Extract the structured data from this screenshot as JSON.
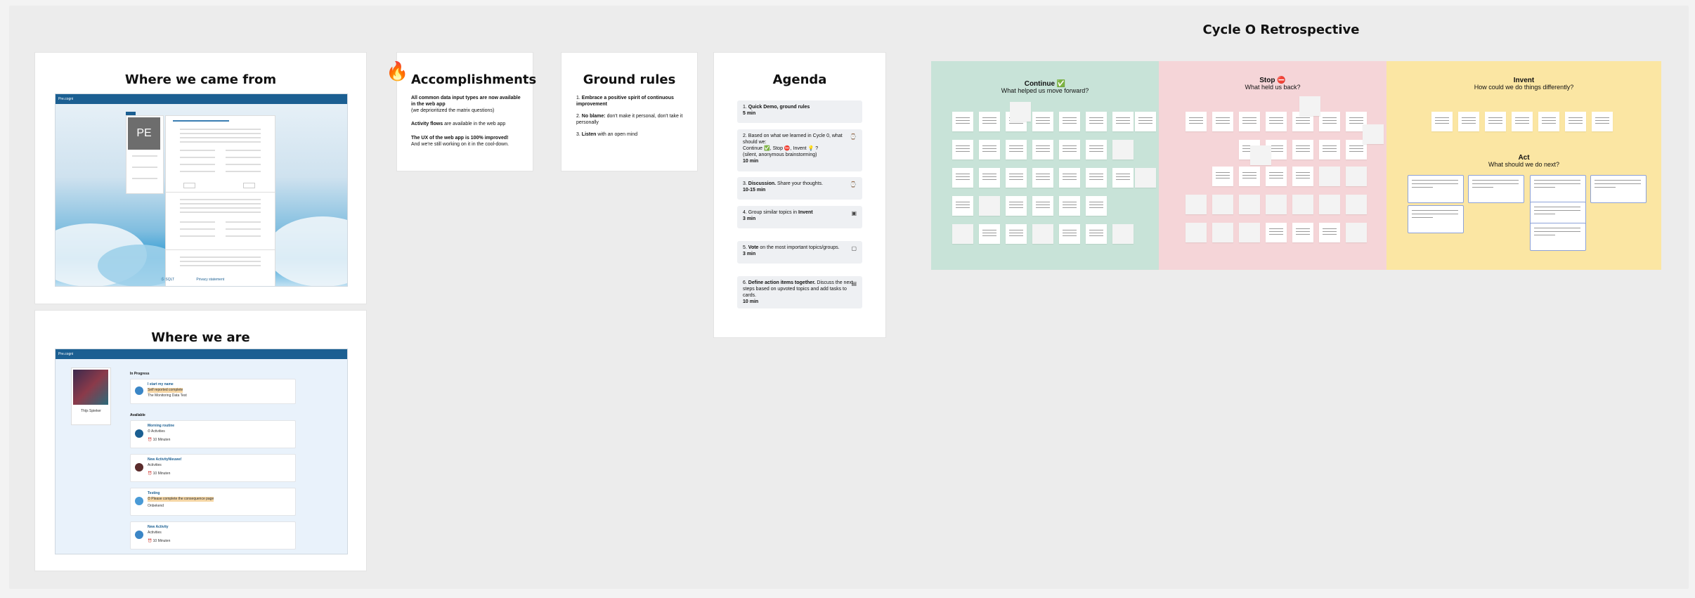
{
  "frames": {
    "came_from": {
      "title": "Where we came from"
    },
    "where_we_are": {
      "title": "Where we are"
    },
    "accomplishments": {
      "title": "Accomplishments",
      "items": [
        {
          "bold": "All common data input types are now available in the web app",
          "rest": "(we deprioritized the matrix questions)"
        },
        {
          "bold": "Activity flows",
          "rest": " are available in the web app"
        },
        {
          "bold": "The UX of the web app is 100% improved!",
          "rest": "And we're still working on it in the cool-down."
        }
      ]
    },
    "ground_rules": {
      "title": "Ground rules",
      "items": [
        {
          "num": "1.",
          "bold": "Embrace a positive spirit of continuous improvement",
          "rest": ""
        },
        {
          "num": "2.",
          "bold": "No blame:",
          "rest": " don't make it personal, don't take it personally"
        },
        {
          "num": "3.",
          "bold": "Listen",
          "rest": " with an open mind"
        }
      ]
    },
    "agenda": {
      "title": "Agenda",
      "items": [
        {
          "num": "1.",
          "bold": "Quick Demo, ground rules",
          "rest": "",
          "time": "5 min",
          "icon": ""
        },
        {
          "num": "2.",
          "bold": "",
          "rest": "Based on what we learned in Cycle 0, what should we:",
          "line2": "Continue ✅, Stop ⛔, Invent 💡 ?",
          "line3": "(silent, anonymous brainstorming)",
          "time": "10 min",
          "icon": "⌚"
        },
        {
          "num": "3.",
          "bold": "Discussion.",
          "rest": " Share your thoughts.",
          "time": "10-15 min",
          "icon": "⌚"
        },
        {
          "num": "4.",
          "bold": "",
          "rest": "Group similar topics in ",
          "bold2": "Invent",
          "time": "3 min",
          "icon": "▣"
        },
        {
          "num": "5.",
          "bold": "Vote",
          "rest": " on the most important topics/groups.",
          "time": "3 min",
          "icon": "▢"
        },
        {
          "num": "6.",
          "bold": "Define action items together.",
          "rest": " Discuss the next steps based on upvoted topics and add tasks to cards.",
          "time": "10 min",
          "icon": "▤"
        }
      ]
    },
    "retro": {
      "title": "Cycle O Retrospective",
      "columns": [
        {
          "title": "Continue ✅",
          "subtitle": "What helped us move forward?",
          "color": "#c8e3d8"
        },
        {
          "title": "Stop ⛔",
          "subtitle": "What held us back?",
          "color": "#f5d5d8"
        },
        {
          "title": "Invent",
          "subtitle": "How could we do things differently?",
          "color": "#fbe6a3",
          "section2_title": "Act",
          "section2_subtitle": "What should we do next?"
        }
      ]
    }
  },
  "screens": {
    "old_app": {
      "brand": "Pre.cogni",
      "avatar_initials": "PE",
      "success_tag": "Ⓢ SQLT",
      "footer_link": "Privacy statement"
    },
    "new_app": {
      "brand": "Pre.cogni",
      "section_in_progress": "In Progress",
      "section_available": "Available",
      "profile_name": "Thijs Spieker",
      "cards": [
        {
          "title": "I start my name",
          "sub": "Self reported complete",
          "meta": "The Monitoring Data Test"
        },
        {
          "title": "Morning routine",
          "sub": "⏱ Activities",
          "meta": "⏰ 10 Minuten"
        },
        {
          "title": "New ActivityNieuwe!",
          "sub": "Activities",
          "meta": "⏰ 10 Minuten"
        },
        {
          "title": "Testing",
          "sub": "⏱ Please complete the consequence page",
          "meta": "Onbekend"
        },
        {
          "title": "New Activity",
          "sub": "Activities",
          "meta": "⏰ 10 Minuten"
        }
      ]
    }
  },
  "colors": {
    "brand_blue": "#1b5f92",
    "continue_bg": "#c8e3d8",
    "stop_bg": "#f5d5d8",
    "invent_bg": "#fbe6a3"
  }
}
